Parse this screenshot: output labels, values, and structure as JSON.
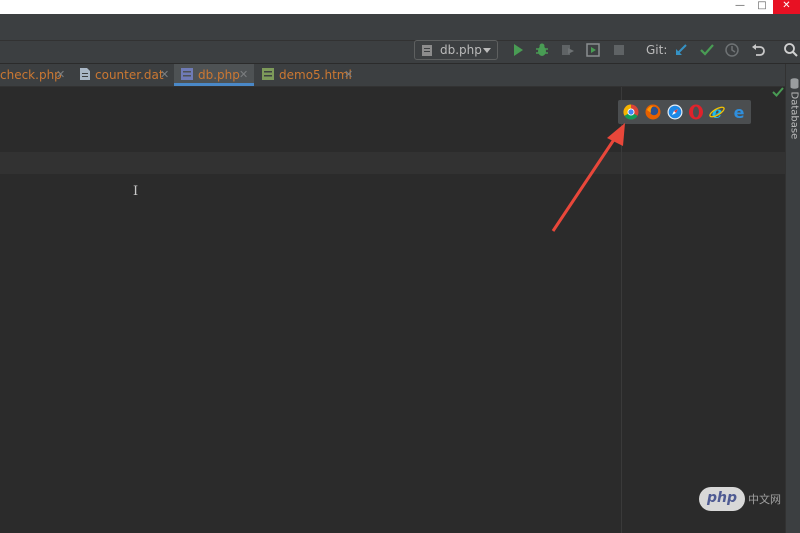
{
  "window": {
    "minimize_glyph": "—",
    "maximize_glyph": "□",
    "close_glyph": "✕"
  },
  "toolbar": {
    "run_config_label": "db.php",
    "git_label": "Git:",
    "icons": [
      "run-icon",
      "debug-icon",
      "coverage-icon",
      "profile-icon",
      "stop-icon",
      "vcs-update-icon",
      "vcs-commit-icon",
      "vcs-history-icon",
      "revert-icon",
      "search-icon"
    ]
  },
  "tabs": [
    {
      "label": "check.php",
      "active": false
    },
    {
      "label": "counter.dat",
      "active": false
    },
    {
      "label": "db.php",
      "active": true
    },
    {
      "label": "demo5.html",
      "active": false
    }
  ],
  "sidebar_right": {
    "database_label": "Database"
  },
  "browser_popup": {
    "browsers": [
      "chrome-icon",
      "firefox-icon",
      "safari-icon",
      "opera-icon",
      "internet-explorer-icon",
      "edge-icon"
    ]
  },
  "colors": {
    "editor_bg": "#2b2b2b",
    "toolbar_bg": "#3c3f41",
    "tab_php_text": "#cc7832",
    "active_tab_underline": "#4a88c7",
    "annotation_arrow": "#e8473a"
  },
  "watermark": {
    "logo_text": "php",
    "suffix_text": "中文网"
  }
}
